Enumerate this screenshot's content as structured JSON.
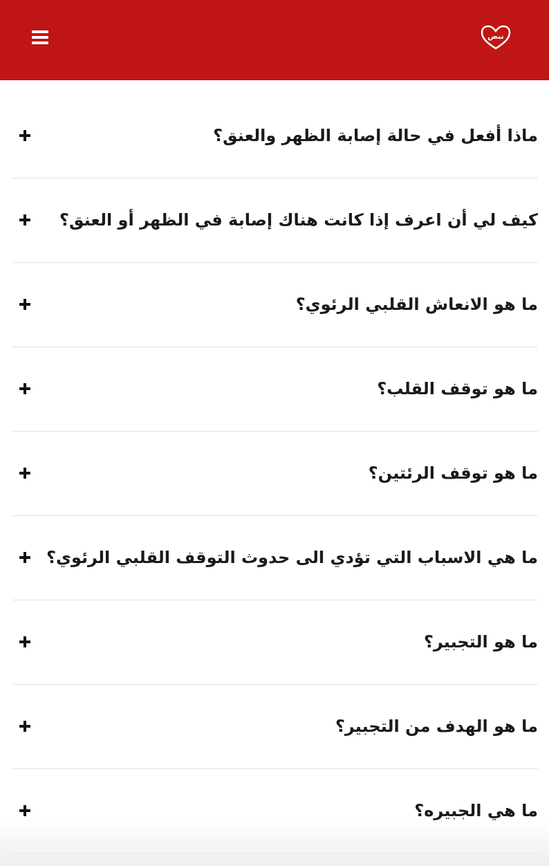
{
  "header": {
    "logo_text": "نبض",
    "logo_icon": "heart-icon",
    "menu_icon": "hamburger-menu-icon",
    "background_color": "#c01515"
  },
  "faq": {
    "items": [
      {
        "question": "ماذا أفعل في حالة إصابة الظهر والعنق؟"
      },
      {
        "question": "كيف لي أن اعرف إذا كانت هناك إصابة في الظهر أو العنق؟"
      },
      {
        "question": "ما هو الانعاش القلبي الرئوي؟"
      },
      {
        "question": "ما هو توقف القلب؟"
      },
      {
        "question": "ما هو توقف الرئتين؟"
      },
      {
        "question": "ما هي الاسباب التي تؤدي الى حدوث التوقف القلبي الرئوي؟"
      },
      {
        "question": "ما هو التجبير؟"
      },
      {
        "question": "ما هو الهدف من التجبير؟"
      },
      {
        "question": "ما هي الجبيره؟"
      }
    ],
    "expand_icon": "plus-icon"
  }
}
